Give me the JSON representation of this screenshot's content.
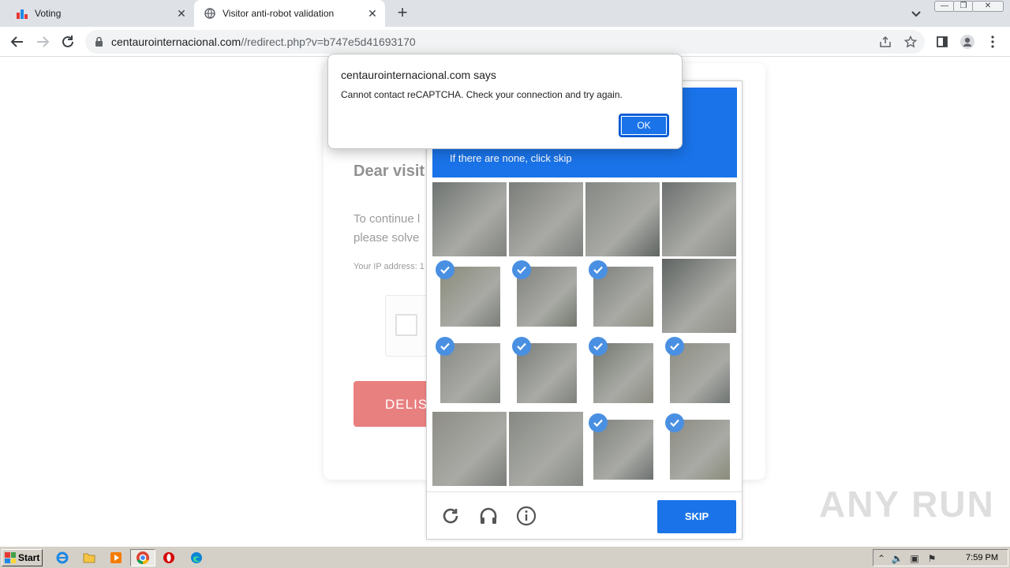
{
  "browser": {
    "tabs": [
      {
        "title": "Voting",
        "active": false
      },
      {
        "title": "Visitor anti-robot validation",
        "active": true
      }
    ],
    "url_domain": "centaurointernacional.com",
    "url_path": "//redirect.php?v=b747e5d41693170"
  },
  "page": {
    "greeting": "Dear visit",
    "instruction_line1": "To continue l",
    "instruction_line2": "please solve",
    "ip_label": "Your IP address: 1",
    "delist_button": "DELIS"
  },
  "recaptcha": {
    "header_subtext": "If there are none, click skip",
    "skip_label": "SKIP",
    "selected_tiles": [
      4,
      5,
      6,
      8,
      9,
      10,
      11,
      14,
      15
    ]
  },
  "alert": {
    "title": "centaurointernacional.com says",
    "message": "Cannot contact reCAPTCHA. Check your connection and try again.",
    "ok_label": "OK"
  },
  "watermark": "ANY RUN",
  "taskbar": {
    "start_label": "Start",
    "clock": "7:59 PM"
  },
  "colors": {
    "accent": "#1a73e8",
    "delist": "#d30000",
    "check": "#4a90e2"
  }
}
